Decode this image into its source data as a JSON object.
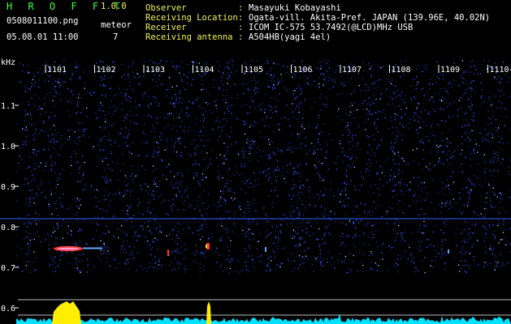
{
  "app": {
    "title": "H R O F F T",
    "version": "1.0.0",
    "filename": "0508011100.png",
    "datetime": "05.08.01 11:00",
    "meteor_label": "meteor",
    "meteor_count": "7"
  },
  "info": [
    {
      "label": "Observer",
      "value": "Masayuki Kobayashi"
    },
    {
      "label": "Receiving Location",
      "value": "Ogata-vill. Akita-Pref. JAPAN (139.96E, 40.02N)"
    },
    {
      "label": "Receiver",
      "value": "ICOM IC-575 53.7492(@LCD)MHz USB"
    },
    {
      "label": "Receiving antenna",
      "value": "A504HB(yagi 4el)"
    }
  ],
  "axis": {
    "unit": "kHz",
    "y_ticks": [
      "1.1",
      "1.0",
      "0.9",
      "0.8",
      "0.7",
      "0.6"
    ],
    "x_ticks": [
      "1101",
      "1102",
      "1103",
      "1104",
      "1105",
      "1106",
      "1107",
      "1108",
      "1109",
      "1110"
    ]
  },
  "colors": {
    "background": "#000000",
    "header_text": "#3cff3c",
    "accent_text": "#f2f25a",
    "spectrum": "#1e3cff",
    "reference_line": "#3060ff",
    "meteor_echo": "#ff3a3a",
    "amplitude": "#00e0ff",
    "amplitude_peak": "#ffee00"
  }
}
